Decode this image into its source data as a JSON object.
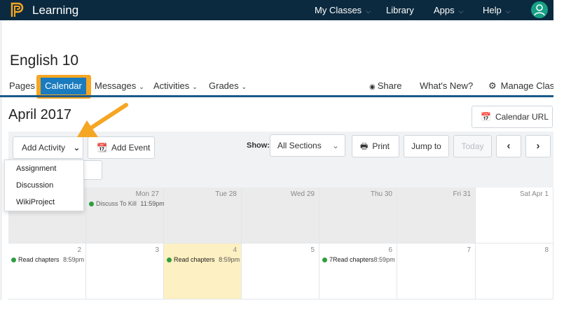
{
  "topbar": {
    "brand": "Learning",
    "nav": [
      {
        "label": "My Classes",
        "has_menu": true
      },
      {
        "label": "Library",
        "has_menu": false
      },
      {
        "label": "Apps",
        "has_menu": true
      },
      {
        "label": "Help",
        "has_menu": true
      }
    ]
  },
  "course": {
    "title": "English 10"
  },
  "tabs": {
    "pages": "Pages",
    "calendar": "Calendar",
    "messages": "Messages",
    "activities": "Activities",
    "grades": "Grades",
    "share": "Share",
    "whats_new": "What's New?",
    "manage": "Manage Class"
  },
  "calendar": {
    "month": "April 2017",
    "calendar_url": "Calendar URL",
    "add_activity": "Add Activity",
    "add_event": "Add Event",
    "show_label": "Show:",
    "sections": "All Sections",
    "print": "Print",
    "jump_to": "Jump to",
    "today": "Today",
    "activity_menu": [
      "Assignment",
      "Discussion",
      "WikiProject"
    ],
    "week1": [
      {
        "label": "",
        "events": []
      },
      {
        "label": "Mon 27",
        "events": [
          {
            "title": "Discuss To Kill",
            "time": "11:59pm",
            "faded": true
          }
        ]
      },
      {
        "label": "Tue 28",
        "events": []
      },
      {
        "label": "Wed 29",
        "events": []
      },
      {
        "label": "Thu 30",
        "events": []
      },
      {
        "label": "Fri 31",
        "events": []
      },
      {
        "label": "Sat Apr 1",
        "events": []
      }
    ],
    "week2": [
      {
        "label": "2",
        "events": [
          {
            "title": "Read chapters",
            "time": "8:59pm"
          }
        ]
      },
      {
        "label": "3",
        "events": []
      },
      {
        "label": "4",
        "events": [
          {
            "title": "Read chapters",
            "time": "8:59pm"
          }
        ]
      },
      {
        "label": "5",
        "events": []
      },
      {
        "label": "6",
        "events": [
          {
            "title": "7Read chapters",
            "time": "8:59pm"
          }
        ]
      },
      {
        "label": "7",
        "events": []
      },
      {
        "label": "8",
        "events": []
      }
    ]
  },
  "colors": {
    "topbar": "#0b2a3f",
    "accent_blue": "#1a7bbf",
    "highlight_orange": "#f5a623",
    "event_green": "#2e9e3e",
    "today_yellow": "#fdf0c2"
  }
}
